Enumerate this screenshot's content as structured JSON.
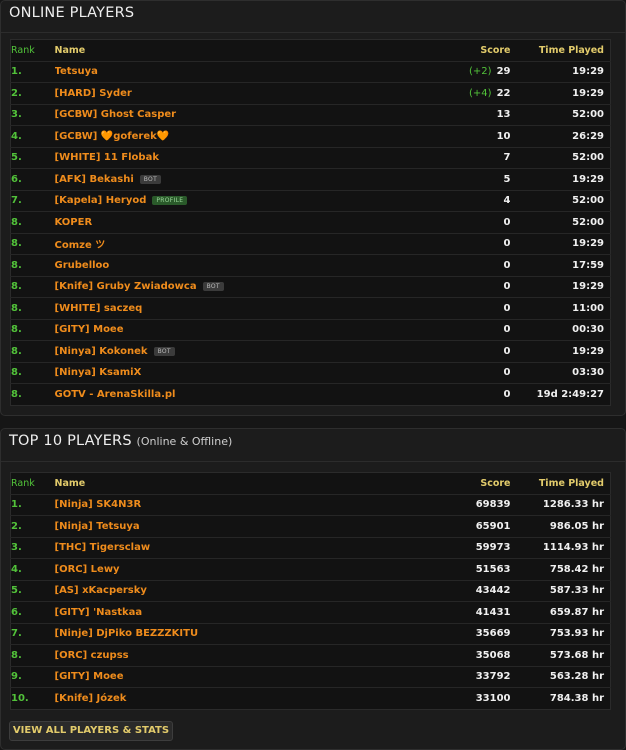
{
  "online": {
    "title": "ONLINE PLAYERS",
    "headers": {
      "rank": "Rank",
      "name": "Name",
      "score": "Score",
      "time": "Time Played"
    },
    "rows": [
      {
        "rank": "1.",
        "name": "Tetsuya",
        "delta": "(+2)",
        "score": "29",
        "time": "19:29"
      },
      {
        "rank": "2.",
        "name": "[HARD] Syder",
        "delta": "(+4)",
        "score": "22",
        "time": "19:29"
      },
      {
        "rank": "3.",
        "name": "[GCBW] Ghost Casper",
        "score": "13",
        "time": "52:00"
      },
      {
        "rank": "4.",
        "name": "[GCBW] 🧡goferek🧡",
        "score": "10",
        "time": "26:29"
      },
      {
        "rank": "5.",
        "name": "[WHITE] 11 Flobak",
        "score": "7",
        "time": "52:00"
      },
      {
        "rank": "6.",
        "name": "[AFK] Bekashi",
        "tag": "BOT",
        "tag_type": "bot",
        "score": "5",
        "time": "19:29"
      },
      {
        "rank": "7.",
        "name": "[Kapela] Heryod",
        "tag": "PROFILE",
        "tag_type": "profile",
        "score": "4",
        "time": "52:00"
      },
      {
        "rank": "8.",
        "name": "KOPER",
        "score": "0",
        "time": "52:00"
      },
      {
        "rank": "8.",
        "name": "Comze ツ",
        "score": "0",
        "time": "19:29"
      },
      {
        "rank": "8.",
        "name": "Grubelloo",
        "score": "0",
        "time": "17:59"
      },
      {
        "rank": "8.",
        "name": "[Knife] Gruby Zwiadowca",
        "tag": "BOT",
        "tag_type": "bot",
        "score": "0",
        "time": "19:29"
      },
      {
        "rank": "8.",
        "name": "[WHITE] saczeq",
        "score": "0",
        "time": "11:00"
      },
      {
        "rank": "8.",
        "name": "[GITY] Moee",
        "score": "0",
        "time": "00:30"
      },
      {
        "rank": "8.",
        "name": "[Ninya] Kokonek",
        "tag": "BOT",
        "tag_type": "bot",
        "score": "0",
        "time": "19:29"
      },
      {
        "rank": "8.",
        "name": "[Ninya] KsamiX",
        "score": "0",
        "time": "03:30"
      },
      {
        "rank": "8.",
        "name": "GOTV - ArenaSkilla.pl",
        "score": "0",
        "time": "19d 2:49:27"
      }
    ]
  },
  "top": {
    "title": "TOP 10 PLAYERS",
    "subtitle": "(Online & Offline)",
    "headers": {
      "rank": "Rank",
      "name": "Name",
      "score": "Score",
      "time": "Time Played"
    },
    "rows": [
      {
        "rank": "1.",
        "name": "[Ninja] SK4N3R",
        "score": "69839",
        "time": "1286.33 hr"
      },
      {
        "rank": "2.",
        "name": "[Ninja] Tetsuya",
        "score": "65901",
        "time": "986.05 hr"
      },
      {
        "rank": "3.",
        "name": "[THC] Tigersclaw",
        "score": "59973",
        "time": "1114.93 hr"
      },
      {
        "rank": "4.",
        "name": "[ORC] Lewy",
        "score": "51563",
        "time": "758.42 hr"
      },
      {
        "rank": "5.",
        "name": "[AS] xKacpersky",
        "score": "43442",
        "time": "587.33 hr"
      },
      {
        "rank": "6.",
        "name": "[GITY] 'Nastkaa",
        "score": "41431",
        "time": "659.87 hr"
      },
      {
        "rank": "7.",
        "name": "[Ninje] DjPiko BEZZZKITU",
        "score": "35669",
        "time": "753.93 hr"
      },
      {
        "rank": "8.",
        "name": "[ORC] czupss",
        "score": "35068",
        "time": "573.68 hr"
      },
      {
        "rank": "9.",
        "name": "[GITY] Moee",
        "score": "33792",
        "time": "563.28 hr"
      },
      {
        "rank": "10.",
        "name": "[Knife] Józek",
        "score": "33100",
        "time": "784.38 hr"
      }
    ],
    "view_all_label": "VIEW ALL PLAYERS & STATS"
  },
  "colors": {
    "rank": "#52c23a",
    "name": "#ef8c1c",
    "header": "#e2cb6b",
    "background": "#161616"
  }
}
